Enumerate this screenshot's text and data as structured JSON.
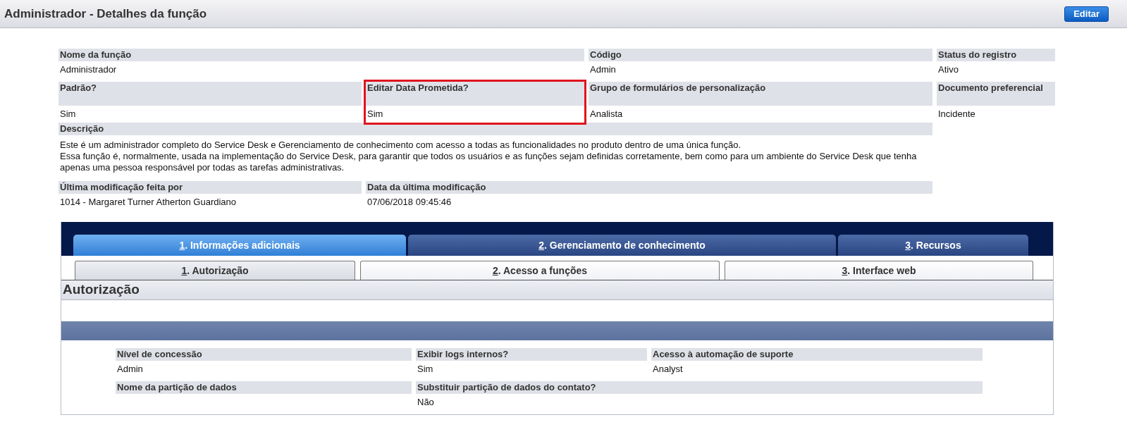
{
  "header": {
    "title": "Administrador - Detalhes da função",
    "edit_button": "Editar"
  },
  "details": {
    "rows": [
      [
        {
          "label": "Nome da função",
          "value": "Administrador"
        },
        {},
        {
          "label": "Código",
          "value": "Admin"
        },
        {
          "label": "Status do registro",
          "value": "Ativo"
        }
      ],
      [
        {
          "label": "Padrão?",
          "value": "Sim"
        },
        {
          "label": "Editar Data Prometida?",
          "value": "Sim",
          "highlighted": true
        },
        {
          "label": "Grupo de formulários de personalização",
          "value": "Analista"
        },
        {
          "label": "Documento preferencial",
          "value": "Incidente"
        }
      ]
    ],
    "description": {
      "label": "Descrição",
      "lines": [
        "Este é um administrador completo do Service Desk e Gerenciamento de conhecimento com acesso a todas as funcionalidades no produto dentro de uma única função.",
        "Essa função é, normalmente, usada na implementação do Service Desk, para garantir que todos os usuários e as funções sejam definidas corretamente, bem como para um ambiente do Service Desk que tenha apenas uma pessoa responsável por todas as tarefas administrativas."
      ]
    },
    "modified": [
      {
        "label": "Última modificação feita por",
        "value": "1014 - Margaret Turner Atherton Guardiano"
      },
      {
        "label": "Data da última modificação",
        "value": "07/06/2018 09:45:46"
      }
    ]
  },
  "tabs": [
    {
      "label": "1. Informações adicionais",
      "selected": true
    },
    {
      "label": "2. Gerenciamento de conhecimento",
      "selected": false
    },
    {
      "label": "3. Recursos",
      "selected": false
    }
  ],
  "subtabs": [
    {
      "label": "1. Autorização",
      "selected": true
    },
    {
      "label": "2. Acesso a funções",
      "selected": false
    },
    {
      "label": "3. Interface web",
      "selected": false
    }
  ],
  "section": {
    "title": "Autorização",
    "rows": [
      [
        {
          "label": "Nível de concessão",
          "value": "Admin"
        },
        {
          "label": "Exibir logs internos?",
          "value": "Sim"
        },
        {
          "label": "Acesso à automação de suporte",
          "value": "Analyst"
        }
      ],
      [
        {
          "label": "Nome da partição de dados"
        },
        {
          "label": "Substituir partição de dados do contato?",
          "value": "Não"
        }
      ]
    ]
  }
}
